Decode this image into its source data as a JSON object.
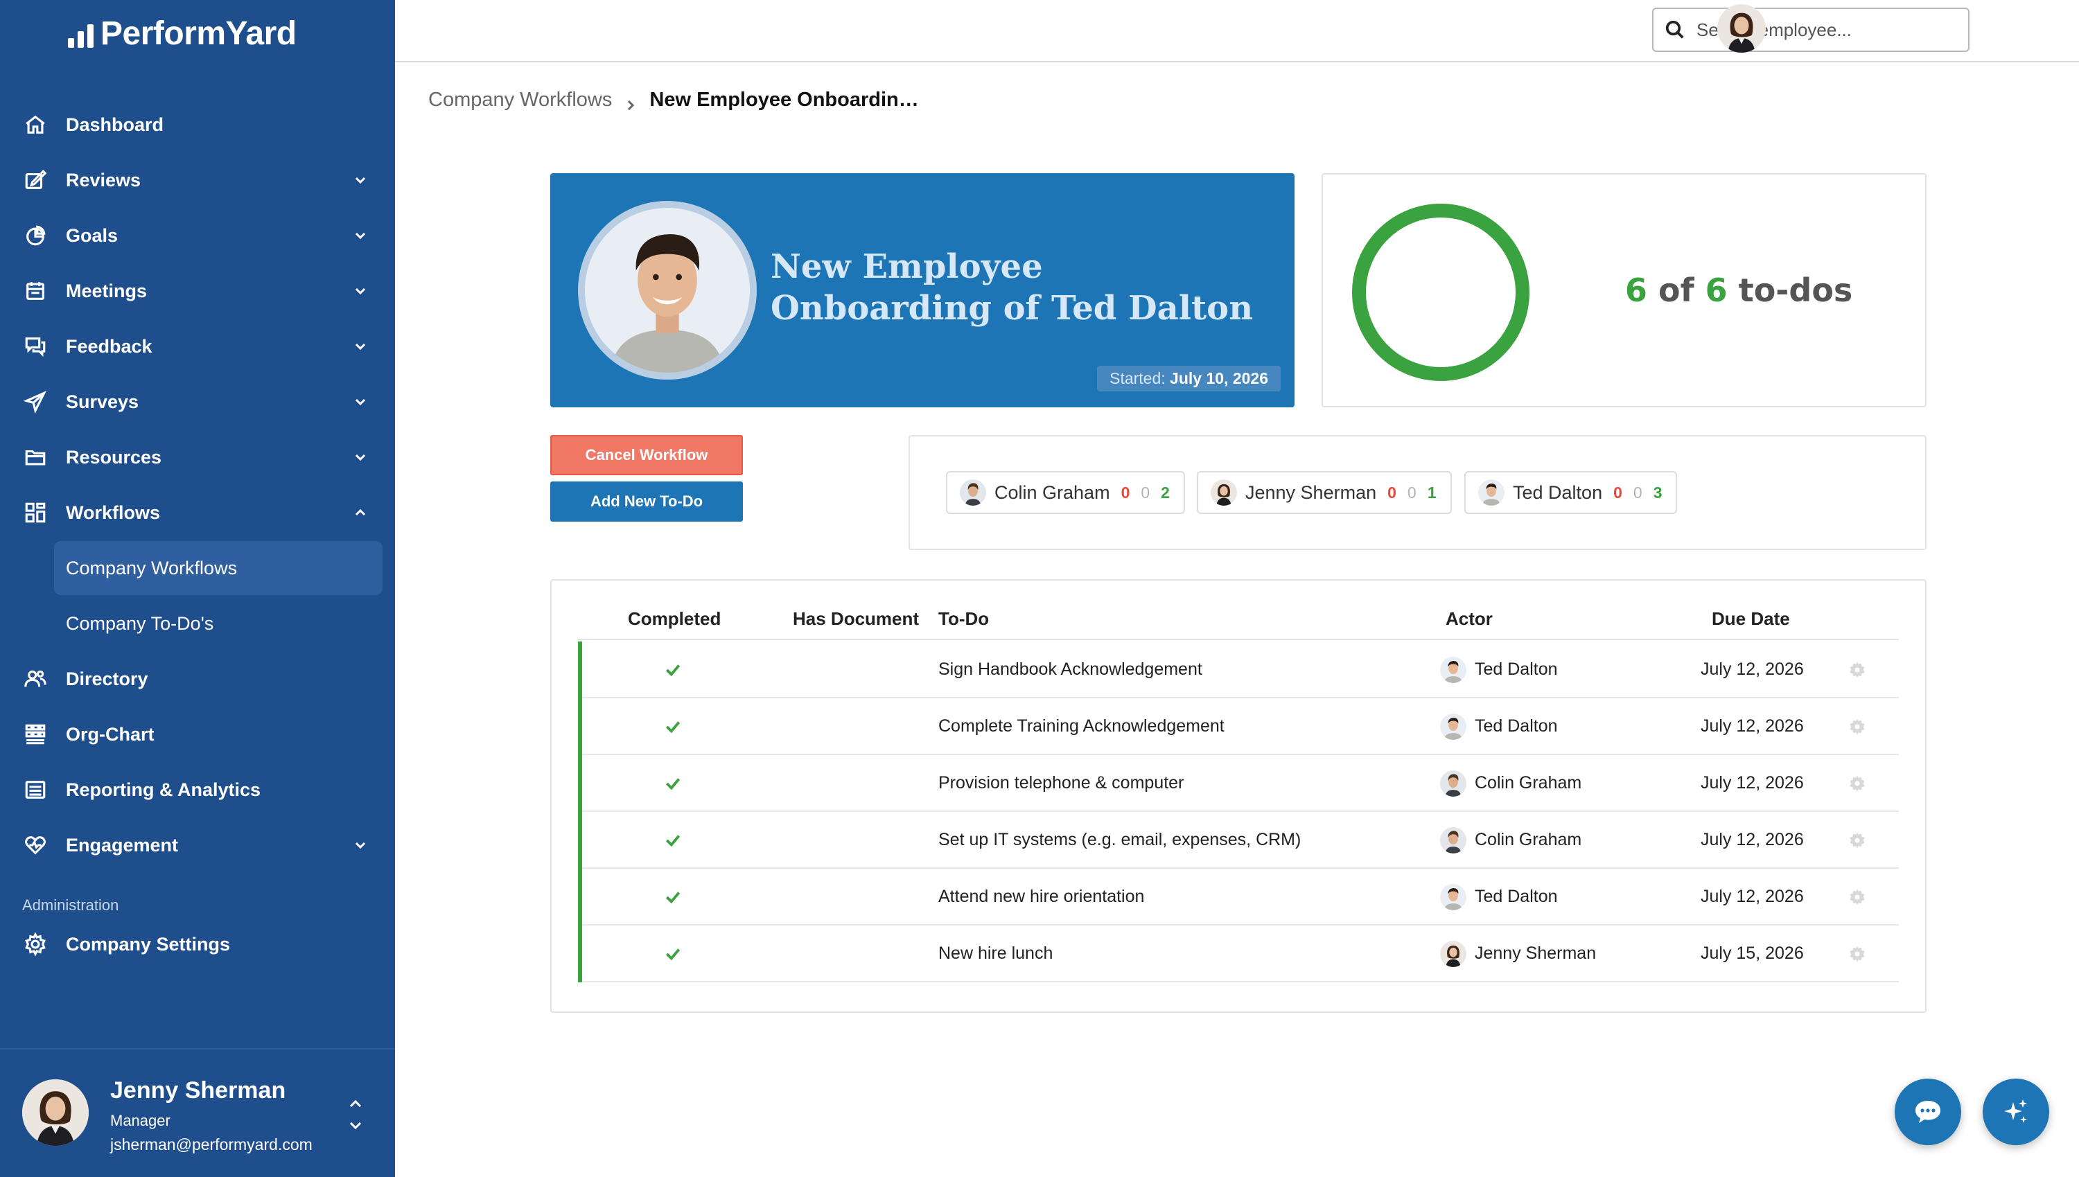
{
  "app": {
    "brand": "PerformYard"
  },
  "colors": {
    "sidebar": "#1f4e8c",
    "primary": "#1d75b6",
    "success": "#3aa340",
    "danger": "#e54a3a",
    "cancel": "#f07865"
  },
  "sidebar": {
    "items": [
      {
        "label": "Dashboard",
        "icon": "home-icon"
      },
      {
        "label": "Reviews",
        "icon": "review-icon"
      },
      {
        "label": "Goals",
        "icon": "pie-chart-icon"
      },
      {
        "label": "Meetings",
        "icon": "calendar-icon"
      },
      {
        "label": "Feedback",
        "icon": "chat-bubbles-icon"
      },
      {
        "label": "Surveys",
        "icon": "paper-plane-icon"
      },
      {
        "label": "Resources",
        "icon": "folder-icon"
      },
      {
        "label": "Workflows",
        "icon": "workflow-icon"
      },
      {
        "label": "Company Workflows"
      },
      {
        "label": "Company To-Do's"
      },
      {
        "label": "Directory",
        "icon": "people-icon"
      },
      {
        "label": "Org-Chart",
        "icon": "org-chart-icon"
      },
      {
        "label": "Reporting & Analytics",
        "icon": "report-icon"
      },
      {
        "label": "Engagement",
        "icon": "heart-icon"
      }
    ],
    "admin_label": "Administration",
    "admin_item": "Company Settings",
    "user": {
      "name": "Jenny Sherman",
      "role": "Manager",
      "email": "jsherman@performyard.com"
    }
  },
  "search": {
    "placeholder": "Search employee..."
  },
  "breadcrumb": {
    "parent": "Company Workflows",
    "current": "New Employee Onboardin…"
  },
  "hero": {
    "title": "New Employee Onboarding of Ted Dalton",
    "started_label": "Started:",
    "started_date": "July 10, 2026"
  },
  "progress": {
    "done": "6",
    "of": "of",
    "total": "6",
    "suffix": "to-dos",
    "fraction": 1.0
  },
  "buttons": {
    "cancel": "Cancel Workflow",
    "add": "Add New To-Do"
  },
  "actors": [
    {
      "name": "Colin Graham",
      "overdue": "0",
      "pending": "0",
      "done": "2"
    },
    {
      "name": "Jenny Sherman",
      "overdue": "0",
      "pending": "0",
      "done": "1"
    },
    {
      "name": "Ted Dalton",
      "overdue": "0",
      "pending": "0",
      "done": "3"
    }
  ],
  "table": {
    "headers": {
      "completed": "Completed",
      "document": "Has Document",
      "todo": "To-Do",
      "actor": "Actor",
      "due": "Due Date"
    },
    "rows": [
      {
        "todo": "Sign Handbook Acknowledgement",
        "actor": "Ted Dalton",
        "due": "July 12, 2026"
      },
      {
        "todo": "Complete Training Acknowledgement",
        "actor": "Ted Dalton",
        "due": "July 12, 2026"
      },
      {
        "todo": "Provision telephone & computer",
        "actor": "Colin Graham",
        "due": "July 12, 2026"
      },
      {
        "todo": "Set up IT systems (e.g. email, expenses, CRM)",
        "actor": "Colin Graham",
        "due": "July 12, 2026"
      },
      {
        "todo": "Attend new hire orientation",
        "actor": "Ted Dalton",
        "due": "July 12, 2026"
      },
      {
        "todo": "New hire lunch",
        "actor": "Jenny Sherman",
        "due": "July 15, 2026"
      }
    ]
  }
}
